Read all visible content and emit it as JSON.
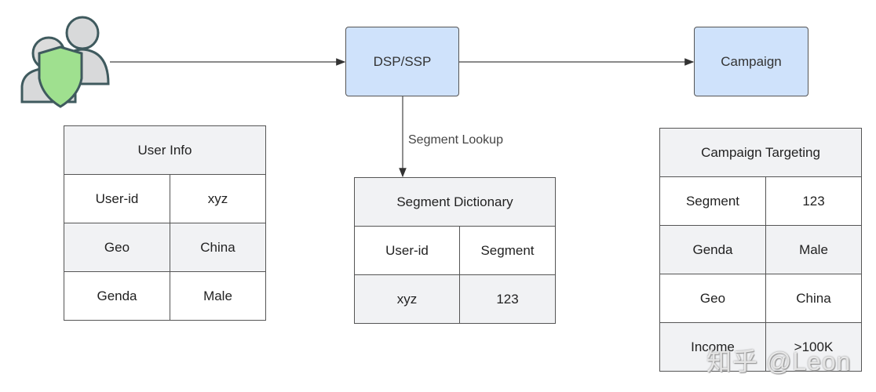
{
  "nodes": {
    "dsp": "DSP/SSP",
    "campaign": "Campaign"
  },
  "edge_label": "Segment Lookup",
  "user_info": {
    "title": "User Info",
    "rows": [
      [
        "User-id",
        "xyz"
      ],
      [
        "Geo",
        "China"
      ],
      [
        "Genda",
        "Male"
      ]
    ]
  },
  "segment_dictionary": {
    "title": "Segment Dictionary",
    "rows": [
      [
        "User-id",
        "Segment"
      ],
      [
        "xyz",
        "123"
      ]
    ]
  },
  "campaign_targeting": {
    "title": "Campaign Targeting",
    "rows": [
      [
        "Segment",
        "123"
      ],
      [
        "Genda",
        "Male"
      ],
      [
        "Geo",
        "China"
      ],
      [
        "Income",
        ">100K"
      ]
    ]
  },
  "watermark": "知乎 @Leon",
  "colors": {
    "node_fill": "#cfe2fb",
    "header_fill": "#f1f2f4",
    "shield": "#9fe08f"
  }
}
